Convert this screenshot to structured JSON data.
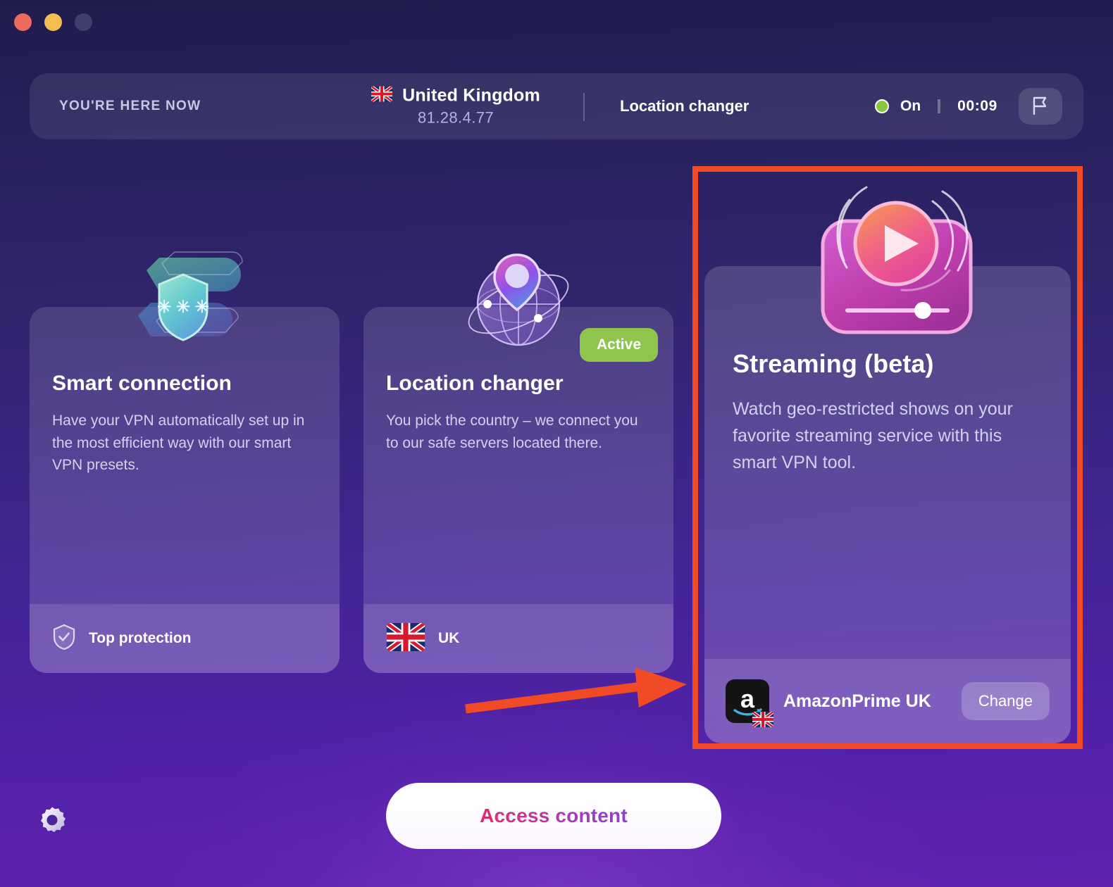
{
  "window": {
    "traffic_lights": [
      "close",
      "minimize",
      "zoom"
    ]
  },
  "header": {
    "here_now_label": "YOU'RE HERE NOW",
    "country": "United Kingdom",
    "ip_address": "81.28.4.77",
    "mode": "Location changer",
    "status_label": "On",
    "timer": "00:09",
    "status_color": "#8cc63e",
    "flag_button_icon": "flag-icon"
  },
  "cards": [
    {
      "id": "smart",
      "title": "Smart connection",
      "description": "Have your VPN automatically set up in the most efficient way with our smart VPN presets.",
      "footer_label": "Top protection",
      "footer_icon": "shield-check-icon",
      "badge": null
    },
    {
      "id": "location",
      "title": "Location changer",
      "description": "You pick the country – we connect you to our safe servers located there.",
      "footer_label": "UK",
      "footer_icon": "uk-flag-icon",
      "badge": "Active"
    },
    {
      "id": "streaming",
      "title": "Streaming (beta)",
      "description": "Watch geo-restricted shows on your favorite streaming service with this smart VPN tool.",
      "footer_label": "AmazonPrime UK",
      "footer_icon": "amazon-prime-icon",
      "change_label": "Change",
      "badge": null
    }
  ],
  "cta": {
    "label": "Access content"
  },
  "settings": {
    "icon": "gear-icon"
  },
  "annotation": {
    "highlight_color": "#f04a26",
    "arrow_target": "streaming-card"
  }
}
